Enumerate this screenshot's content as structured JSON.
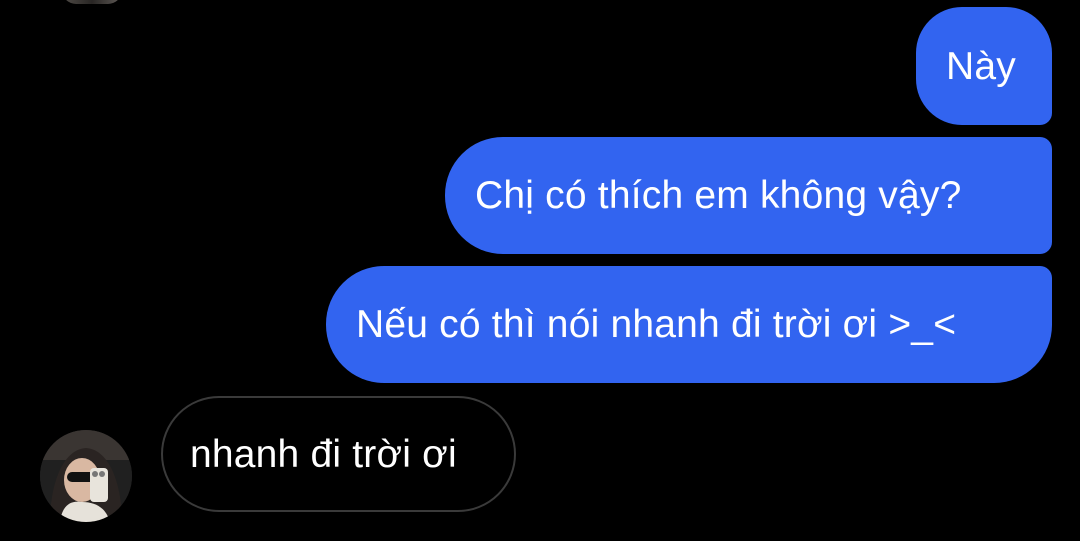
{
  "conversation": {
    "messages": [
      {
        "sender": "me",
        "text": "Này"
      },
      {
        "sender": "me",
        "text": "Chị có thích em không vậy?"
      },
      {
        "sender": "me",
        "text": "Nếu có thì nói nhanh đi trời ơi >_<"
      },
      {
        "sender": "other",
        "text": "nhanh đi trời ơi"
      }
    ]
  },
  "colors": {
    "background": "#000000",
    "outgoing_bubble": "#3264f0",
    "incoming_bubble_border": "#3a3a3a",
    "text": "#ffffff"
  },
  "icons": {
    "contact_avatar": "avatar-photo"
  }
}
